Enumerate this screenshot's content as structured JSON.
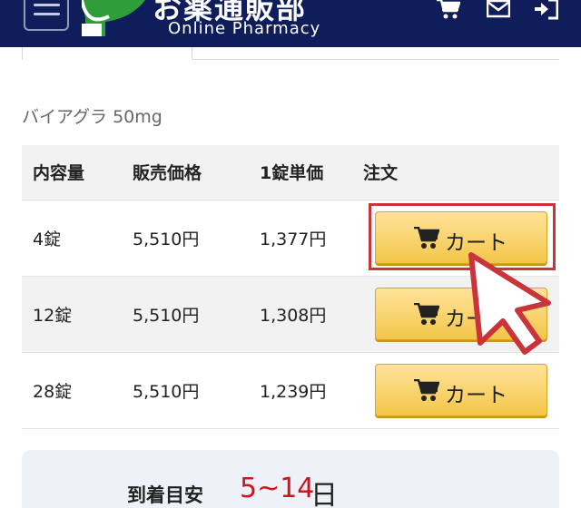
{
  "header": {
    "brand_jp": "お薬通販部",
    "brand_en": "Online Pharmacy",
    "icons": [
      "menu-icon",
      "cart-icon",
      "mail-icon",
      "login-icon"
    ],
    "colors": {
      "background": "#0f1e5a",
      "leaf": "#2e9e3a"
    }
  },
  "product": {
    "title": "バイアグラ 50mg"
  },
  "table": {
    "headers": [
      "内容量",
      "販売価格",
      "1錠単価",
      "注文"
    ],
    "rows": [
      {
        "qty": "4錠",
        "price": "5,510円",
        "unit": "1,377円",
        "button": "カート"
      },
      {
        "qty": "12錠",
        "price": "5,510円",
        "unit": "1,308円",
        "button": "カート"
      },
      {
        "qty": "28錠",
        "price": "5,510円",
        "unit": "1,239円",
        "button": "カート"
      }
    ]
  },
  "arrival": {
    "label": "到着目安",
    "value": "5~14",
    "unit": "日"
  },
  "colors": {
    "accent_red": "#c9343b",
    "button_gold": "#f3c649",
    "value_red": "#d0141c"
  }
}
